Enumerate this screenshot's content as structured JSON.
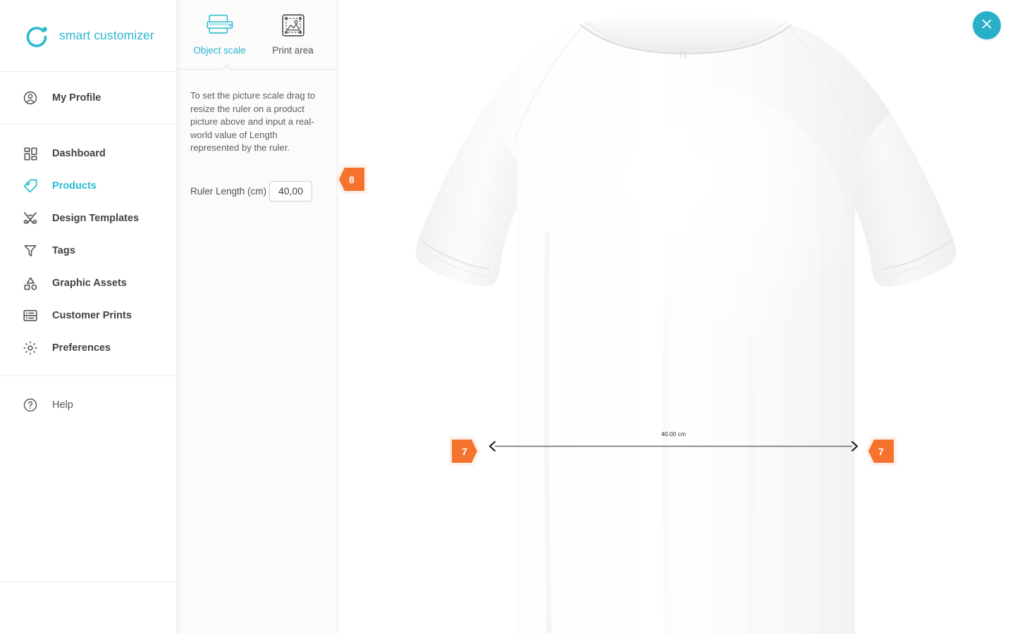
{
  "brand": {
    "name": "smart customizer",
    "logo_icon": "smart-customizer-logo",
    "accent_color": "#29b6cd"
  },
  "sidebar": {
    "groups": [
      {
        "items": [
          {
            "label": "My Profile",
            "icon": "user-circle-icon",
            "active": false
          }
        ]
      },
      {
        "items": [
          {
            "label": "Dashboard",
            "icon": "dashboard-grid-icon",
            "active": false
          },
          {
            "label": "Products",
            "icon": "tag-icon",
            "active": true
          },
          {
            "label": "Design Templates",
            "icon": "design-tools-icon",
            "active": false
          },
          {
            "label": "Tags",
            "icon": "funnel-icon",
            "active": false
          },
          {
            "label": "Graphic Assets",
            "icon": "shapes-icon",
            "active": false
          },
          {
            "label": "Customer Prints",
            "icon": "prints-stack-icon",
            "active": false
          },
          {
            "label": "Preferences",
            "icon": "gear-icon",
            "active": false
          }
        ]
      },
      {
        "items": [
          {
            "label": "Help",
            "icon": "question-circle-icon",
            "active": false
          }
        ]
      }
    ]
  },
  "panel": {
    "tabs": [
      {
        "label": "Object scale",
        "icon": "ruler-on-image-icon",
        "active": true
      },
      {
        "label": "Print area",
        "icon": "print-area-icon",
        "active": false
      }
    ],
    "help_text": "To set the picture scale drag to resize the ruler on a product picture above and input a real-world value of Length represented by the ruler.",
    "field": {
      "label": "Ruler Length (cm)",
      "value": "40,00",
      "placeholder": "0,00"
    }
  },
  "badges": {
    "step_input": "8",
    "step_handle_left": "7",
    "step_handle_right": "7",
    "color": "#f5732d",
    "glow_color": "#fdf0e8"
  },
  "canvas": {
    "product_alt": "white crew-neck t-shirt back view",
    "ruler_measurement_label": "40.00 cm"
  },
  "close_button": {
    "icon": "close-icon",
    "color": "#29b0c9"
  }
}
